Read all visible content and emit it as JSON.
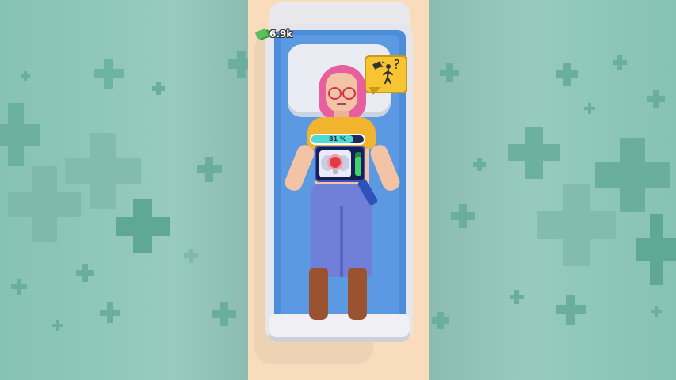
{
  "hud": {
    "money_icon": "cash-icon",
    "money_value": "6.9k"
  },
  "hint_bubble": {
    "icon": "falling-person-hint-icon"
  },
  "scanner": {
    "progress_label": "81 %",
    "progress_percent": 81,
    "target_icon": "red-target-icon"
  },
  "colors": {
    "background": "#8fc2b6",
    "plus": "#64aa9c",
    "phone_background": "#f8dcbc",
    "mattress": "#4d8cd8",
    "hint_bubble": "#f7c531",
    "progress_fill": "#4ddccf"
  }
}
